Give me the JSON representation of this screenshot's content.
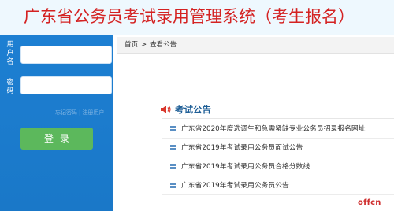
{
  "header": {
    "title": "广东省公务员考试录用管理系统（考生报名）"
  },
  "login": {
    "username_label": "用户名",
    "password_label": "密码",
    "username_value": "",
    "password_value": "",
    "forgot_password_link": "忘记密码",
    "separator": "|",
    "register_link": "注册用户",
    "login_button": "登录"
  },
  "breadcrumb": {
    "home": "首页",
    "separator": ">",
    "current": "查看公告"
  },
  "notices": {
    "heading": "考试公告",
    "items": [
      "广东省2020年度选调生和急需紧缺专业公务员招录报名网址",
      "广东省2019年考试录用公务员面试公告",
      "广东省2019年考试录用公务员合格分数线",
      "广东省2019年考试录用公务员公告"
    ]
  },
  "watermark": "offcn",
  "colors": {
    "title_red": "#d42222",
    "sidebar_blue": "#1d7fd2",
    "login_green": "#5cb85c",
    "heading_blue": "#1e5e96"
  }
}
